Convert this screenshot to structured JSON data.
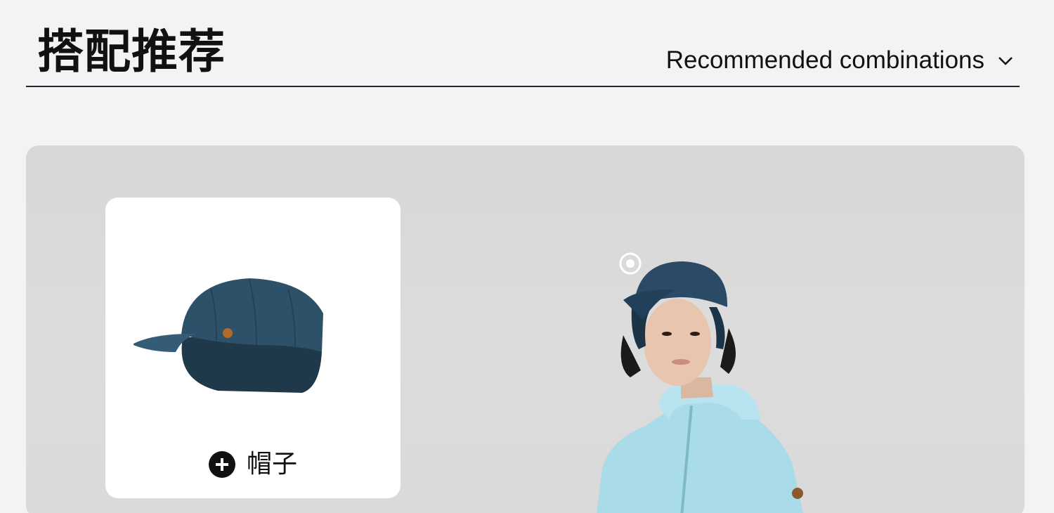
{
  "header": {
    "title": "搭配推荐",
    "dropdown_label": "Recommended combinations",
    "dropdown_icon": "chevron-down-icon"
  },
  "hero": {
    "image": "model-wearing-cap-and-light-blue-hoodie",
    "hotspot_icon": "hotspot-target-icon"
  },
  "product_card": {
    "image": "navy-cap-with-ear-flaps",
    "add_icon": "plus-circle-icon",
    "label": "帽子"
  },
  "colors": {
    "page_bg": "#f3f3f3",
    "divider": "#1c2a38",
    "cap_navy": "#2a4a66",
    "hoodie_blue": "#a9dbe8"
  }
}
